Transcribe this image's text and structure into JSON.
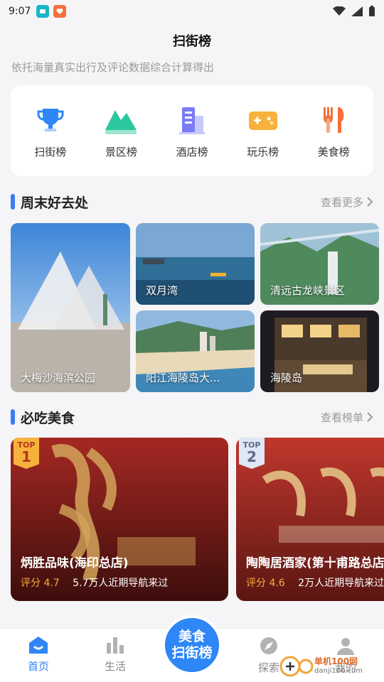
{
  "status_bar": {
    "time": "9:07"
  },
  "header": {
    "title": "扫街榜",
    "subtitle": "依托海量真实出行及评论数据综合计算得出"
  },
  "categories": [
    {
      "label": "扫街榜",
      "icon": "trophy-icon",
      "color": "#2f86f6"
    },
    {
      "label": "景区榜",
      "icon": "mountain-icon",
      "color": "#2bc8a0"
    },
    {
      "label": "酒店榜",
      "icon": "building-icon",
      "color": "#7a7cf5"
    },
    {
      "label": "玩乐榜",
      "icon": "gamepad-icon",
      "color": "#f7b23b"
    },
    {
      "label": "美食榜",
      "icon": "utensils-icon",
      "color": "#f36f3a"
    }
  ],
  "weekend": {
    "title": "周末好去处",
    "more": "查看更多",
    "places": [
      {
        "name": "大梅沙海滨公园"
      },
      {
        "name": "双月湾"
      },
      {
        "name": "清远古龙峡景区"
      },
      {
        "name": "阳江海陵岛大..."
      },
      {
        "name": "海陵岛"
      }
    ]
  },
  "food": {
    "title": "必吃美食",
    "more": "查看榜单",
    "items": [
      {
        "top_label": "TOP",
        "rank": "1",
        "name": "炳胜品味(海印总店)",
        "score": "评分 4.7",
        "visits": "5.7万人近期导航来过"
      },
      {
        "top_label": "TOP",
        "rank": "2",
        "name": "陶陶居酒家(第十甫路总店",
        "score": "评分 4.6",
        "visits": "2万人近期导航来过"
      }
    ]
  },
  "bottom_nav": {
    "items": [
      {
        "label": "首页",
        "icon": "home-icon",
        "active": true
      },
      {
        "label": "生活",
        "icon": "bar-chart-icon",
        "active": false
      },
      {
        "label": "探索",
        "icon": "compass-icon",
        "active": false
      },
      {
        "label": "我的",
        "icon": "user-icon",
        "active": false
      }
    ],
    "center_label_1": "美食",
    "center_label_2": "扫街榜"
  },
  "watermark": {
    "line1": "单机100网",
    "line2": "danji100.com"
  },
  "colors": {
    "accent": "#2f86f6",
    "score": "#f7b23b"
  }
}
